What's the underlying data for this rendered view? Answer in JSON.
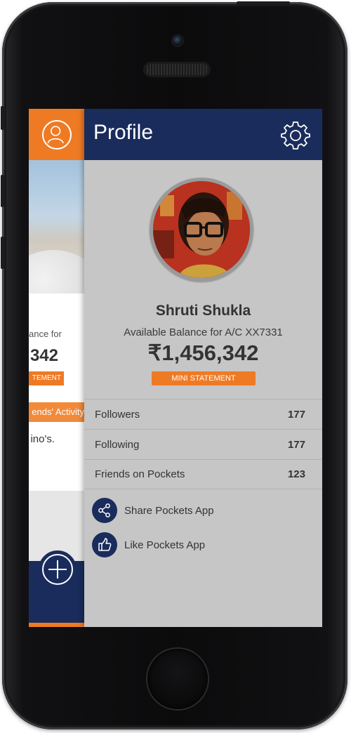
{
  "peek": {
    "balance_text": "ance for",
    "amount": "342",
    "mini_label": "TEMENT",
    "activity_label": "ends' Activity",
    "feed_text": "ino's."
  },
  "header": {
    "title": "Profile"
  },
  "profile": {
    "name": "Shruti Shukla",
    "balance_label": "Available Balance for A/C XX7331",
    "balance_amount": "₹1,456,342",
    "mini_statement_label": "MINI STATEMENT"
  },
  "stats": [
    {
      "label": "Followers",
      "value": "177"
    },
    {
      "label": "Following",
      "value": "177"
    },
    {
      "label": "Friends on Pockets",
      "value": "123"
    }
  ],
  "actions": [
    {
      "label": "Share Pockets App",
      "icon": "share-icon"
    },
    {
      "label": "Like Pockets App",
      "icon": "thumbs-up-icon"
    }
  ],
  "colors": {
    "brand_navy": "#1a2c5c",
    "accent_orange": "#ef7a24",
    "drawer_bg": "#c6c6c6"
  }
}
